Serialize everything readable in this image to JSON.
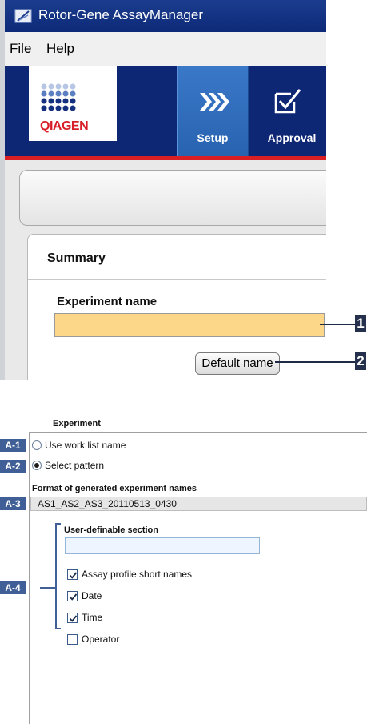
{
  "window": {
    "title": "Rotor-Gene AssayManager"
  },
  "menu": {
    "items": [
      "File",
      "Help"
    ]
  },
  "brand": {
    "logo_text": "QIAGEN",
    "accent": "#d81e28",
    "nav_bg": "#0e2775",
    "active_tab": "#2f6dbc"
  },
  "nav": {
    "tabs": [
      {
        "label": "Setup",
        "icon": "chevrons-icon",
        "active": true
      },
      {
        "label": "Approval",
        "icon": "checkbox-icon",
        "active": false
      }
    ]
  },
  "summary": {
    "title": "Summary",
    "experiment_name_label": "Experiment name",
    "experiment_name_value": "",
    "default_name_button": "Default name"
  },
  "callouts": [
    "1",
    "2"
  ],
  "experiment": {
    "section_title": "Experiment",
    "options": [
      {
        "tag": "A-1",
        "label": "Use work list name",
        "selected": false
      },
      {
        "tag": "A-2",
        "label": "Select pattern",
        "selected": true
      }
    ],
    "format_label": "Format of generated experiment names",
    "format_tag": "A-3",
    "format_value": "AS1_AS2_AS3_20110513_0430",
    "user_section_label": "User-definable section",
    "user_section_value": "",
    "group_tag": "A-4",
    "checkboxes": [
      {
        "label": "Assay profile short names",
        "checked": true
      },
      {
        "label": "Date",
        "checked": true
      },
      {
        "label": "Time",
        "checked": true
      },
      {
        "label": "Operator",
        "checked": false
      }
    ]
  }
}
